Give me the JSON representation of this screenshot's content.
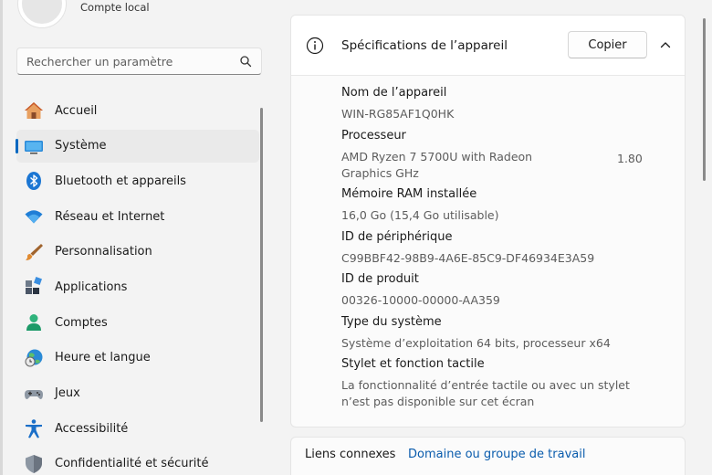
{
  "account": {
    "type": "Compte local"
  },
  "search": {
    "placeholder": "Rechercher un paramètre"
  },
  "nav": {
    "items": [
      {
        "label": "Accueil"
      },
      {
        "label": "Système",
        "selected": true
      },
      {
        "label": "Bluetooth et appareils"
      },
      {
        "label": "Réseau et Internet"
      },
      {
        "label": "Personnalisation"
      },
      {
        "label": "Applications"
      },
      {
        "label": "Comptes"
      },
      {
        "label": "Heure et langue"
      },
      {
        "label": "Jeux"
      },
      {
        "label": "Accessibilité"
      },
      {
        "label": "Confidentialité et sécurité"
      }
    ]
  },
  "device_specs": {
    "title": "Spécifications de l’appareil",
    "copy_label": "Copier",
    "specs": [
      {
        "label": "Nom de l’appareil",
        "value": "WIN-RG85AF1Q0HK"
      },
      {
        "label": "Processeur",
        "value": "AMD Ryzen 7 5700U with Radeon Graphics GHz",
        "extra": "1.80"
      },
      {
        "label": "Mémoire RAM installée",
        "value": "16,0 Go (15,4 Go utilisable)"
      },
      {
        "label": "ID de périphérique",
        "value": "C99BBF42-98B9-4A6E-85C9-DF46934E3A59"
      },
      {
        "label": "ID de produit",
        "value": "00326-10000-00000-AA359"
      },
      {
        "label": "Type du système",
        "value": "Système d’exploitation 64 bits, processeur x64"
      },
      {
        "label": "Stylet et fonction tactile",
        "value": "La fonctionnalité d’entrée tactile ou avec un stylet n’est pas disponible sur cet écran"
      }
    ]
  },
  "related": {
    "label": "Liens connexes",
    "link": "Domaine ou groupe de travail"
  },
  "colors": {
    "accent": "#0067c0",
    "link": "#0a5cad",
    "background": "#f3f3f3"
  }
}
